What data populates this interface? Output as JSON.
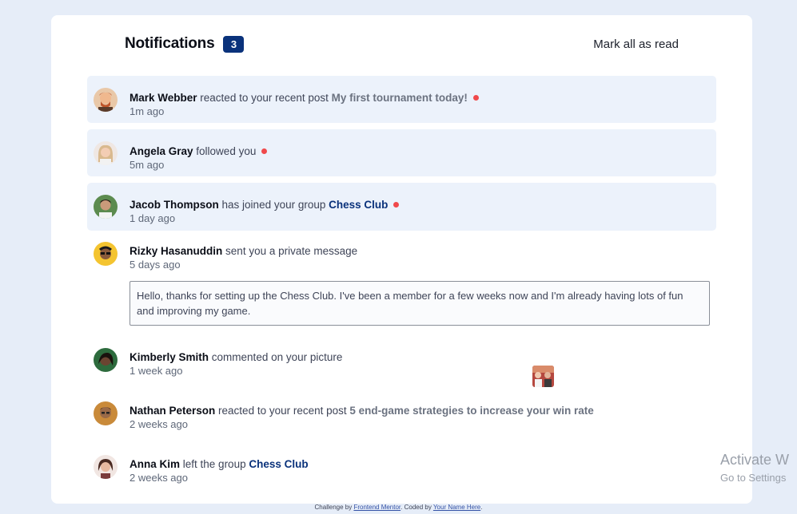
{
  "header": {
    "title": "Notifications",
    "unread_count": "3",
    "mark_all": "Mark all as read"
  },
  "notifications": [
    {
      "name": "Mark Webber",
      "action": "reacted to your recent post",
      "target": "My first tournament today!",
      "time": "1m ago",
      "unread": true
    },
    {
      "name": "Angela Gray",
      "action": "followed you",
      "time": "5m ago",
      "unread": true
    },
    {
      "name": "Jacob Thompson",
      "action": "has joined your group",
      "target": "Chess Club",
      "time": "1 day ago",
      "unread": true
    },
    {
      "name": "Rizky Hasanuddin",
      "action": "sent you a private message",
      "time": "5 days ago",
      "message": "Hello, thanks for setting up the Chess Club. I've been a member for a few weeks now and I'm already having lots of fun and improving my game."
    },
    {
      "name": "Kimberly Smith",
      "action": "commented on your picture",
      "time": "1 week ago"
    },
    {
      "name": "Nathan Peterson",
      "action": "reacted to your recent post",
      "target": "5 end-game strategies to increase your win rate",
      "time": "2 weeks ago"
    },
    {
      "name": "Anna Kim",
      "action": "left the group",
      "target": "Chess Club",
      "time": "2 weeks ago"
    }
  ],
  "footer": {
    "prefix": "Challenge by",
    "fm": "Frontend Mentor",
    "mid": ". Coded by",
    "author": "Your Name Here",
    "suffix": "."
  },
  "watermark": {
    "line1": "Activate W",
    "line2": "Go to Settings"
  },
  "colors": {
    "unread_bg": "#ecf2fb",
    "badge": "#0a327b",
    "dot": "#f0494b",
    "page_bg": "#e6edf8"
  }
}
